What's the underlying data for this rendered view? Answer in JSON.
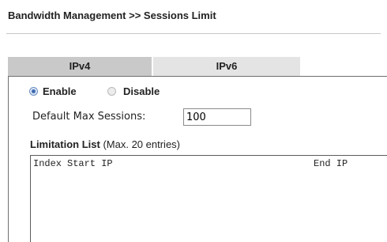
{
  "header": {
    "title": "Bandwidth Management >> Sessions Limit"
  },
  "tabs": [
    {
      "label": "IPv4",
      "active": true
    },
    {
      "label": "IPv6",
      "active": false
    }
  ],
  "mode": {
    "options": [
      {
        "label": "Enable",
        "checked": true
      },
      {
        "label": "Disable",
        "checked": false
      }
    ]
  },
  "default_max": {
    "label": "Default Max Sessions:",
    "value": "100"
  },
  "limitation_list": {
    "heading": "Limitation List",
    "note": "(Max. 20 entries)",
    "columns": [
      "Index",
      "Start IP",
      "End IP"
    ],
    "rows": []
  },
  "colors": {
    "tab_active": "#c9c9c9",
    "tab_inactive": "#e4e4e4",
    "radio_checked": "#3e6bb0",
    "border": "#6f6f6f"
  }
}
